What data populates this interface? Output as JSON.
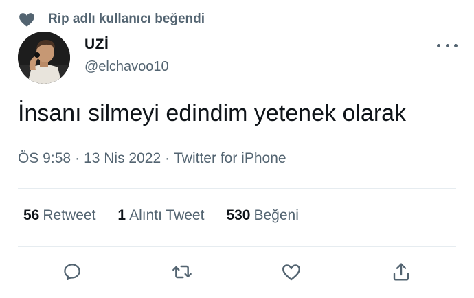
{
  "social_context": {
    "icon": "heart-icon",
    "text": "Rip adlı kullanıcı beğendi"
  },
  "author": {
    "display_name": "UZİ",
    "handle": "@elchavoo10",
    "avatar_icon": "avatar-photo"
  },
  "more_icon": "more-icon",
  "tweet": {
    "text": "İnsanı silmeyi edindim yetenek olarak",
    "time": "ÖS 9:58",
    "separator": "·",
    "date": "13 Nis 2022",
    "source": "Twitter for iPhone"
  },
  "stats": [
    {
      "count": "56",
      "label": "Retweet"
    },
    {
      "count": "1",
      "label": "Alıntı Tweet"
    },
    {
      "count": "530",
      "label": "Beğeni"
    }
  ],
  "actions": [
    {
      "name": "reply",
      "icon": "reply-icon"
    },
    {
      "name": "retweet",
      "icon": "retweet-icon"
    },
    {
      "name": "like",
      "icon": "heart-outline-icon"
    },
    {
      "name": "share",
      "icon": "share-icon"
    }
  ],
  "colors": {
    "primary_text": "#0f1419",
    "secondary_text": "#536471",
    "divider": "#e6ecf0"
  }
}
